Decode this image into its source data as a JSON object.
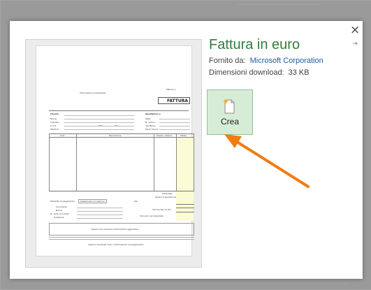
{
  "dialog": {
    "close_label": "×",
    "pin_label": "⇥",
    "title": "Fattura in euro",
    "provider_label": "Fornito da:",
    "provider_value": "Microsoft Corporation",
    "download_label": "Dimensioni download:",
    "download_value": "33 KB",
    "create_label": "Crea",
    "create_icon": "new-document-icon"
  },
  "preview": {
    "invoice_word": "FATTURA",
    "company_info": "Informazioni sull'azienda",
    "invoice_no": "Fattura n.",
    "cliente": "Cliente",
    "spedizione": "Spedizione a",
    "fields_left": [
      "Nome",
      "Indirizzo",
      "C.A.P.",
      "Telefono"
    ],
    "city": "Città",
    "prov": "Prov.",
    "fields_right": [
      "Data",
      "N. ordine",
      "Venditore",
      "Porto franco"
    ],
    "col_headers": [
      "Q.tà",
      "Descrizione",
      "Prezzo unitario",
      "Totale"
    ],
    "totals": [
      "Subtotale",
      "Spese di spedizione"
    ],
    "payment": "Modalità di pagamento",
    "payment_select": "Selezionare un'opzione",
    "payment_fields": [
      "Commenti",
      "Nome",
      "N. carta di credito",
      "Scadenza"
    ],
    "vat": "IVA",
    "rate": "TOT CL'IVA 17,5%",
    "office_use": "Solo per uso aziendale",
    "notes_line": "Inserire qui eventuali informazioni aggiuntive",
    "footer": "Inserire eventuali note o informazioni sul pagamento"
  },
  "colors": {
    "accent_green": "#2e7d3c",
    "link_blue": "#1e5aa8",
    "button_bg": "#d7ecd7",
    "arrow_orange": "#f07d0e"
  }
}
